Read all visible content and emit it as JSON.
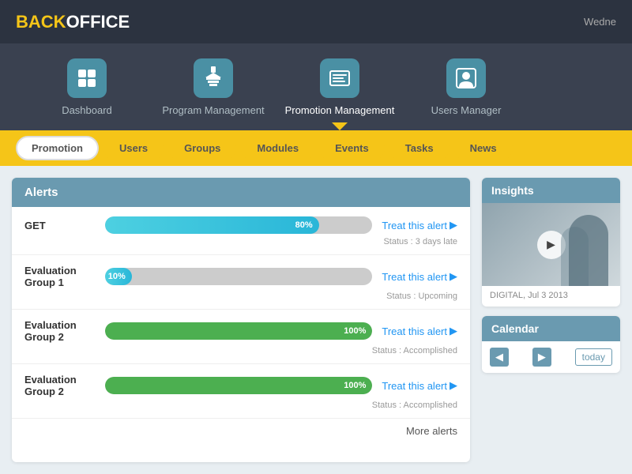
{
  "app": {
    "logo_back": "BACK",
    "logo_office": "OFFICE",
    "header_date": "Wedne"
  },
  "nav": {
    "items": [
      {
        "id": "dashboard",
        "label": "Dashboard",
        "icon": "⊞",
        "active": false
      },
      {
        "id": "program",
        "label": "Program Management",
        "icon": "🎫",
        "active": false
      },
      {
        "id": "promotion",
        "label": "Promotion Management",
        "icon": "📋",
        "active": true
      },
      {
        "id": "users",
        "label": "Users Manager",
        "icon": "📇",
        "active": false
      }
    ]
  },
  "subnav": {
    "tabs": [
      {
        "id": "promotion",
        "label": "Promotion",
        "active": true
      },
      {
        "id": "users",
        "label": "Users",
        "active": false
      },
      {
        "id": "groups",
        "label": "Groups",
        "active": false
      },
      {
        "id": "modules",
        "label": "Modules",
        "active": false
      },
      {
        "id": "events",
        "label": "Events",
        "active": false
      },
      {
        "id": "tasks",
        "label": "Tasks",
        "active": false
      },
      {
        "id": "news",
        "label": "News",
        "active": false
      }
    ]
  },
  "alerts": {
    "panel_title": "Alerts",
    "items": [
      {
        "id": "get",
        "name": "GET",
        "progress": 80,
        "progress_color": "blue",
        "status": "Status : 3 days late",
        "treat_label": "Treat this alert"
      },
      {
        "id": "eval1",
        "name": "Evaluation Group 1",
        "progress": 10,
        "progress_color": "blue-partial",
        "status": "Status : Upcoming",
        "treat_label": "Treat this alert"
      },
      {
        "id": "eval2a",
        "name": "Evaluation Group 2",
        "progress": 100,
        "progress_color": "green",
        "status": "Status : Accomplished",
        "treat_label": "Treat this alert"
      },
      {
        "id": "eval2b",
        "name": "Evaluation Group 2",
        "progress": 100,
        "progress_color": "green",
        "status": "Status : Accomplished",
        "treat_label": "Treat this alert"
      }
    ],
    "more_label": "More alerts"
  },
  "insights": {
    "panel_title": "Insights",
    "caption": "DIGITAL, Jul 3 2013"
  },
  "calendar": {
    "panel_title": "Calendar",
    "today_label": "today"
  }
}
